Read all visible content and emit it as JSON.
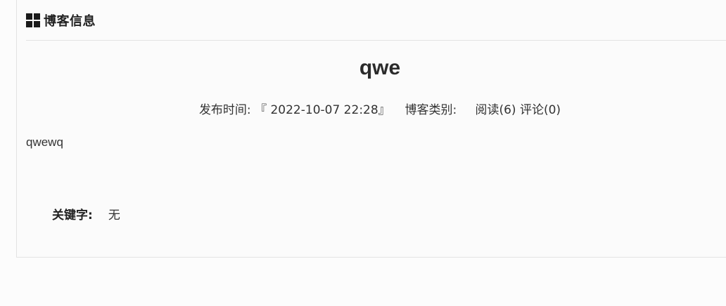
{
  "header": {
    "icon": "grid-icon",
    "title": "博客信息"
  },
  "blog": {
    "title": "qwe",
    "publish_label": "发布时间:",
    "publish_time": "『 2022-10-07 22:28』",
    "category_label": "博客类别:",
    "category_value": "",
    "read": "阅读(6)",
    "comment": "评论(0)",
    "content": "qwewq",
    "keywords_label": "关键字:",
    "keywords_value": "无"
  }
}
